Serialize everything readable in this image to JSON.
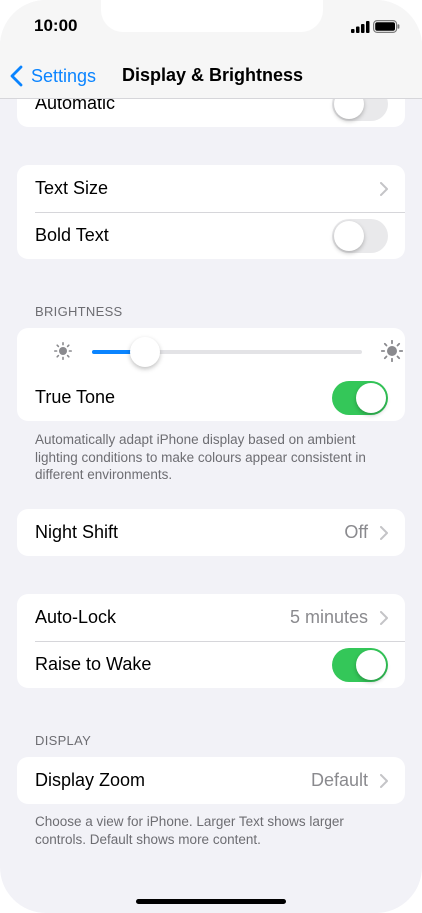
{
  "status_bar": {
    "time": "10:00"
  },
  "nav": {
    "back_label": "Settings",
    "title": "Display & Brightness"
  },
  "appearance": {
    "automatic_label": "Automatic",
    "automatic_on": false
  },
  "text": {
    "text_size_label": "Text Size",
    "bold_text_label": "Bold Text",
    "bold_text_on": false
  },
  "brightness": {
    "header": "BRIGHTNESS",
    "level": 0.15,
    "true_tone_label": "True Tone",
    "true_tone_on": true,
    "footer": "Automatically adapt iPhone display based on ambient lighting conditions to make colours appear consistent in different environments."
  },
  "night_shift": {
    "label": "Night Shift",
    "value": "Off"
  },
  "lock": {
    "auto_lock_label": "Auto-Lock",
    "auto_lock_value": "5 minutes",
    "raise_to_wake_label": "Raise to Wake",
    "raise_to_wake_on": true
  },
  "display": {
    "header": "DISPLAY",
    "zoom_label": "Display Zoom",
    "zoom_value": "Default",
    "footer": "Choose a view for iPhone. Larger Text shows larger controls. Default shows more content."
  },
  "colors": {
    "accent": "#0a84ff",
    "toggle_on": "#34c759",
    "background": "#f2f2f7"
  }
}
